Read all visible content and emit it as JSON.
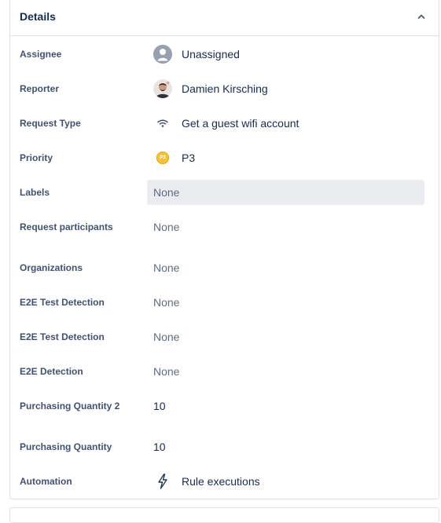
{
  "panel": {
    "title": "Details",
    "collapse_icon": "chevron-up-icon"
  },
  "fields": [
    {
      "label": "Assignee",
      "value": "Unassigned",
      "icon": "default-avatar-icon"
    },
    {
      "label": "Reporter",
      "value": "Damien Kirsching",
      "icon": "user-avatar"
    },
    {
      "label": "Request Type",
      "value": "Get a guest wifi account",
      "icon": "wifi-icon"
    },
    {
      "label": "Priority",
      "value": "P3",
      "icon": "priority-p3-icon",
      "badge": "P3",
      "badge_color": "#f5c33b"
    },
    {
      "label": "Labels",
      "value": "None"
    },
    {
      "label": "Request participants",
      "value": "None"
    },
    {
      "label": "Organizations",
      "value": "None"
    },
    {
      "label": "E2E Test Detection",
      "value": "None"
    },
    {
      "label": "E2E Test Detection",
      "value": "None"
    },
    {
      "label": "E2E Detection",
      "value": "None"
    },
    {
      "label": "Purchasing Quantity 2",
      "value": "10"
    },
    {
      "label": "Purchasing Quantity",
      "value": "10"
    },
    {
      "label": "Automation",
      "value": "Rule executions",
      "icon": "lightning-bolt-icon"
    }
  ],
  "colors": {
    "label": "#42526e",
    "value": "#172b4d",
    "muted": "#5e6c84",
    "border": "#dfe1e6",
    "hover": "#ebecf0"
  }
}
